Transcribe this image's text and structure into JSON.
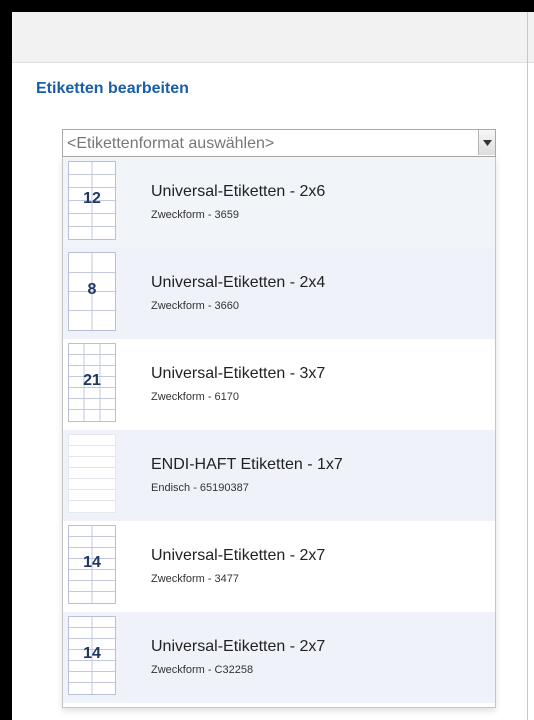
{
  "heading": "Etiketten bearbeiten",
  "select": {
    "placeholder": "<Etikettenformat auswählen>"
  },
  "items": [
    {
      "count": "12",
      "title": "Universal-Etiketten - 2x6",
      "subtitle": "Zweckform - 3659"
    },
    {
      "count": "8",
      "title": "Universal-Etiketten - 2x4",
      "subtitle": "Zweckform - 3660"
    },
    {
      "count": "21",
      "title": "Universal-Etiketten - 3x7",
      "subtitle": "Zweckform - 6170"
    },
    {
      "count": "",
      "title": "ENDI-HAFT Etiketten - 1x7",
      "subtitle": "Endisch - 65190387"
    },
    {
      "count": "14",
      "title": "Universal-Etiketten - 2x7",
      "subtitle": "Zweckform - 3477"
    },
    {
      "count": "14",
      "title": "Universal-Etiketten - 2x7",
      "subtitle": "Zweckform - C32258"
    }
  ],
  "colors": {
    "heading": "#1a5fa6",
    "row_alt": "#eff3f9",
    "thumb_number": "#1f3863"
  }
}
